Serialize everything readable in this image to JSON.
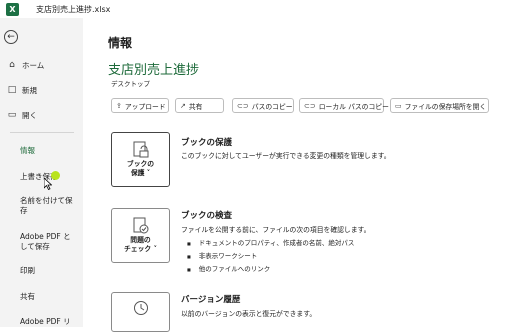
{
  "titlebar": {
    "app_logo": "X",
    "title": "支店別売上進捗.xlsx"
  },
  "sidebar": {
    "items": [
      {
        "label": "ホーム",
        "icon": "home-icon"
      },
      {
        "label": "新規",
        "icon": "new-document-icon"
      },
      {
        "label": "開く",
        "icon": "folder-icon"
      }
    ],
    "subitems": [
      "情報",
      "上書き保存",
      "名前を付けて保存",
      "Adobe PDF として保存",
      "印刷",
      "共有",
      "Adobe PDF リ"
    ]
  },
  "main": {
    "heading": "情報",
    "file_name": "支店別売上進捗",
    "file_location": "デスクトップ",
    "buttons": [
      {
        "label": "アップロード",
        "icon": "upload-icon"
      },
      {
        "label": "共有",
        "icon": "share-icon"
      },
      {
        "label": "パスのコピー",
        "icon": "link-icon"
      },
      {
        "label": "ローカル パスのコピー",
        "icon": "link-icon"
      },
      {
        "label": "ファイルの保存場所を開く",
        "icon": "folder-icon"
      }
    ],
    "sections": [
      {
        "card_label_1": "ブックの",
        "card_label_2": "保護 ˅",
        "title": "ブックの保護",
        "desc": "このブックに対してユーザーが実行できる変更の種類を管理します。"
      },
      {
        "card_label_1": "問題の",
        "card_label_2": "チェック ˅",
        "title": "ブックの検査",
        "desc": "ファイルを公開する前に、ファイルの次の項目を確認します。",
        "bullets": [
          "ドキュメントのプロパティ、作成者の名前、絶対パス",
          "非表示ワークシート",
          "他のファイルへのリンク"
        ]
      },
      {
        "title": "バージョン履歴",
        "desc": "以前のバージョンの表示と復元ができます。"
      }
    ]
  },
  "colors": {
    "accent": "#1d6a3a",
    "excel_green": "#1d7044",
    "sidebar_bg": "#f3f3f3",
    "hover": "#b9e31c"
  }
}
